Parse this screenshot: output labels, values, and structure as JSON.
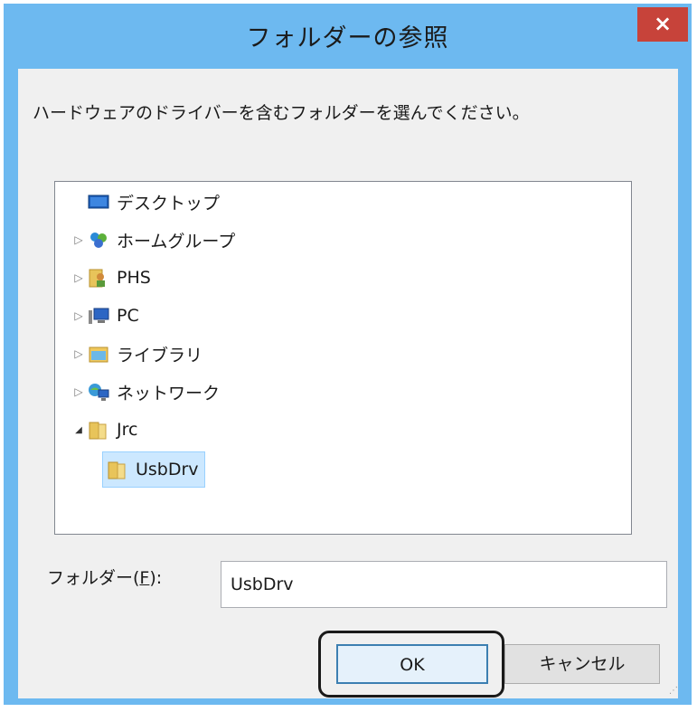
{
  "dialog": {
    "title": "フォルダーの参照",
    "close_label": "×",
    "instruction": "ハードウェアのドライバーを含むフォルダーを選んでください。"
  },
  "tree": {
    "items": [
      {
        "label": "デスクトップ",
        "icon": "desktop-icon",
        "expander": ""
      },
      {
        "label": "ホームグループ",
        "icon": "homegroup-icon",
        "expander": "▷"
      },
      {
        "label": "PHS",
        "icon": "user-folder-icon",
        "expander": "▷"
      },
      {
        "label": "PC",
        "icon": "computer-icon",
        "expander": "▷"
      },
      {
        "label": "ライブラリ",
        "icon": "library-icon",
        "expander": "▷"
      },
      {
        "label": "ネットワーク",
        "icon": "network-icon",
        "expander": "▷"
      },
      {
        "label": "Jrc",
        "icon": "folder-icon",
        "expander": "◢"
      },
      {
        "label": "UsbDrv",
        "icon": "folder-icon",
        "expander": "",
        "selected": true
      }
    ]
  },
  "folder_field": {
    "label": "フォルダー(",
    "accel": "F",
    "label_end": "):",
    "value": "UsbDrv"
  },
  "buttons": {
    "ok": "OK",
    "cancel": "キャンセル"
  },
  "colors": {
    "titlebar": "#6db9f0",
    "close": "#c7433a",
    "selection": "#cce8ff"
  }
}
